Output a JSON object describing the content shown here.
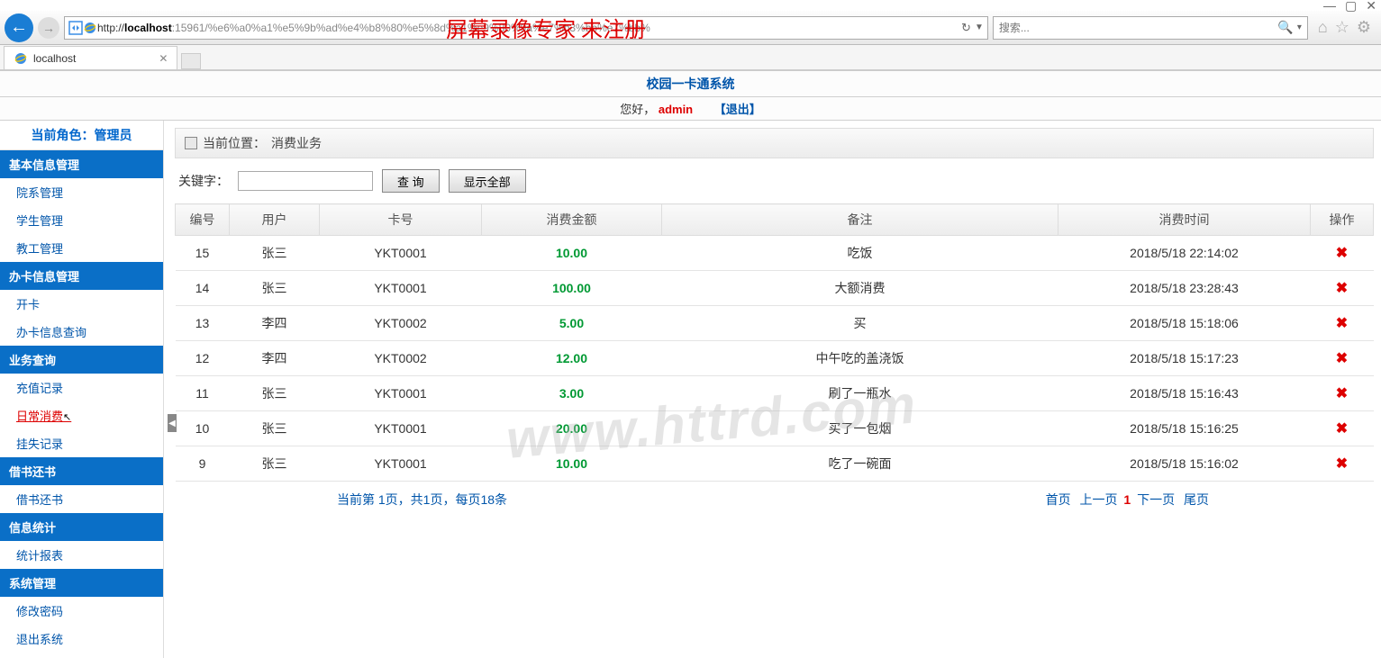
{
  "browser": {
    "url_prefix": "http://",
    "url_host": "localhost",
    "url_path": ":15961/%e6%a0%a1%e5%9b%ad%e4%b8%80%e5%8d%a1%e9%80%9a%e7%b3%bb%e7%bb%",
    "search_placeholder": "搜索...",
    "tab_title": "localhost",
    "overlay": "屏幕录像专家 未注册"
  },
  "app": {
    "system_title": "校园一卡通系统",
    "greet": "您好，",
    "username": "admin",
    "logout": "【退出】"
  },
  "sidebar": {
    "role_label": "当前角色：管理员",
    "groups": [
      {
        "header": "基本信息管理",
        "items": [
          "院系管理",
          "学生管理",
          "教工管理"
        ]
      },
      {
        "header": "办卡信息管理",
        "items": [
          "开卡",
          "办卡信息查询"
        ]
      },
      {
        "header": "业务查询",
        "items": [
          "充值记录",
          "日常消费",
          "挂失记录"
        ]
      },
      {
        "header": "借书还书",
        "items": [
          "借书还书"
        ]
      },
      {
        "header": "信息统计",
        "items": [
          "统计报表"
        ]
      },
      {
        "header": "系统管理",
        "items": [
          "修改密码",
          "退出系统"
        ]
      }
    ],
    "active_item": "日常消费"
  },
  "breadcrumb": {
    "label": "当前位置：",
    "value": "消费业务"
  },
  "search": {
    "label": "关键字：",
    "query_btn": "查 询",
    "showall_btn": "显示全部"
  },
  "table": {
    "headers": [
      "编号",
      "用户",
      "卡号",
      "消费金额",
      "备注",
      "消费时间",
      "操作"
    ],
    "rows": [
      {
        "id": "15",
        "user": "张三",
        "card": "YKT0001",
        "amount": "10.00",
        "note": "吃饭",
        "time": "2018/5/18 22:14:02"
      },
      {
        "id": "14",
        "user": "张三",
        "card": "YKT0001",
        "amount": "100.00",
        "note": "大额消费",
        "time": "2018/5/18 23:28:43"
      },
      {
        "id": "13",
        "user": "李四",
        "card": "YKT0002",
        "amount": "5.00",
        "note": "买",
        "time": "2018/5/18 15:18:06"
      },
      {
        "id": "12",
        "user": "李四",
        "card": "YKT0002",
        "amount": "12.00",
        "note": "中午吃的盖浇饭",
        "time": "2018/5/18 15:17:23"
      },
      {
        "id": "11",
        "user": "张三",
        "card": "YKT0001",
        "amount": "3.00",
        "note": "刷了一瓶水",
        "time": "2018/5/18 15:16:43"
      },
      {
        "id": "10",
        "user": "张三",
        "card": "YKT0001",
        "amount": "20.00",
        "note": "买了一包烟",
        "time": "2018/5/18 15:16:25"
      },
      {
        "id": "9",
        "user": "张三",
        "card": "YKT0001",
        "amount": "10.00",
        "note": "吃了一碗面",
        "time": "2018/5/18 15:16:02"
      }
    ]
  },
  "pager": {
    "info": "当前第 1页，共1页，每页18条",
    "first": "首页",
    "prev": "上一页",
    "current": "1",
    "next": "下一页",
    "last": "尾页"
  },
  "watermark": "www.httrd.com"
}
